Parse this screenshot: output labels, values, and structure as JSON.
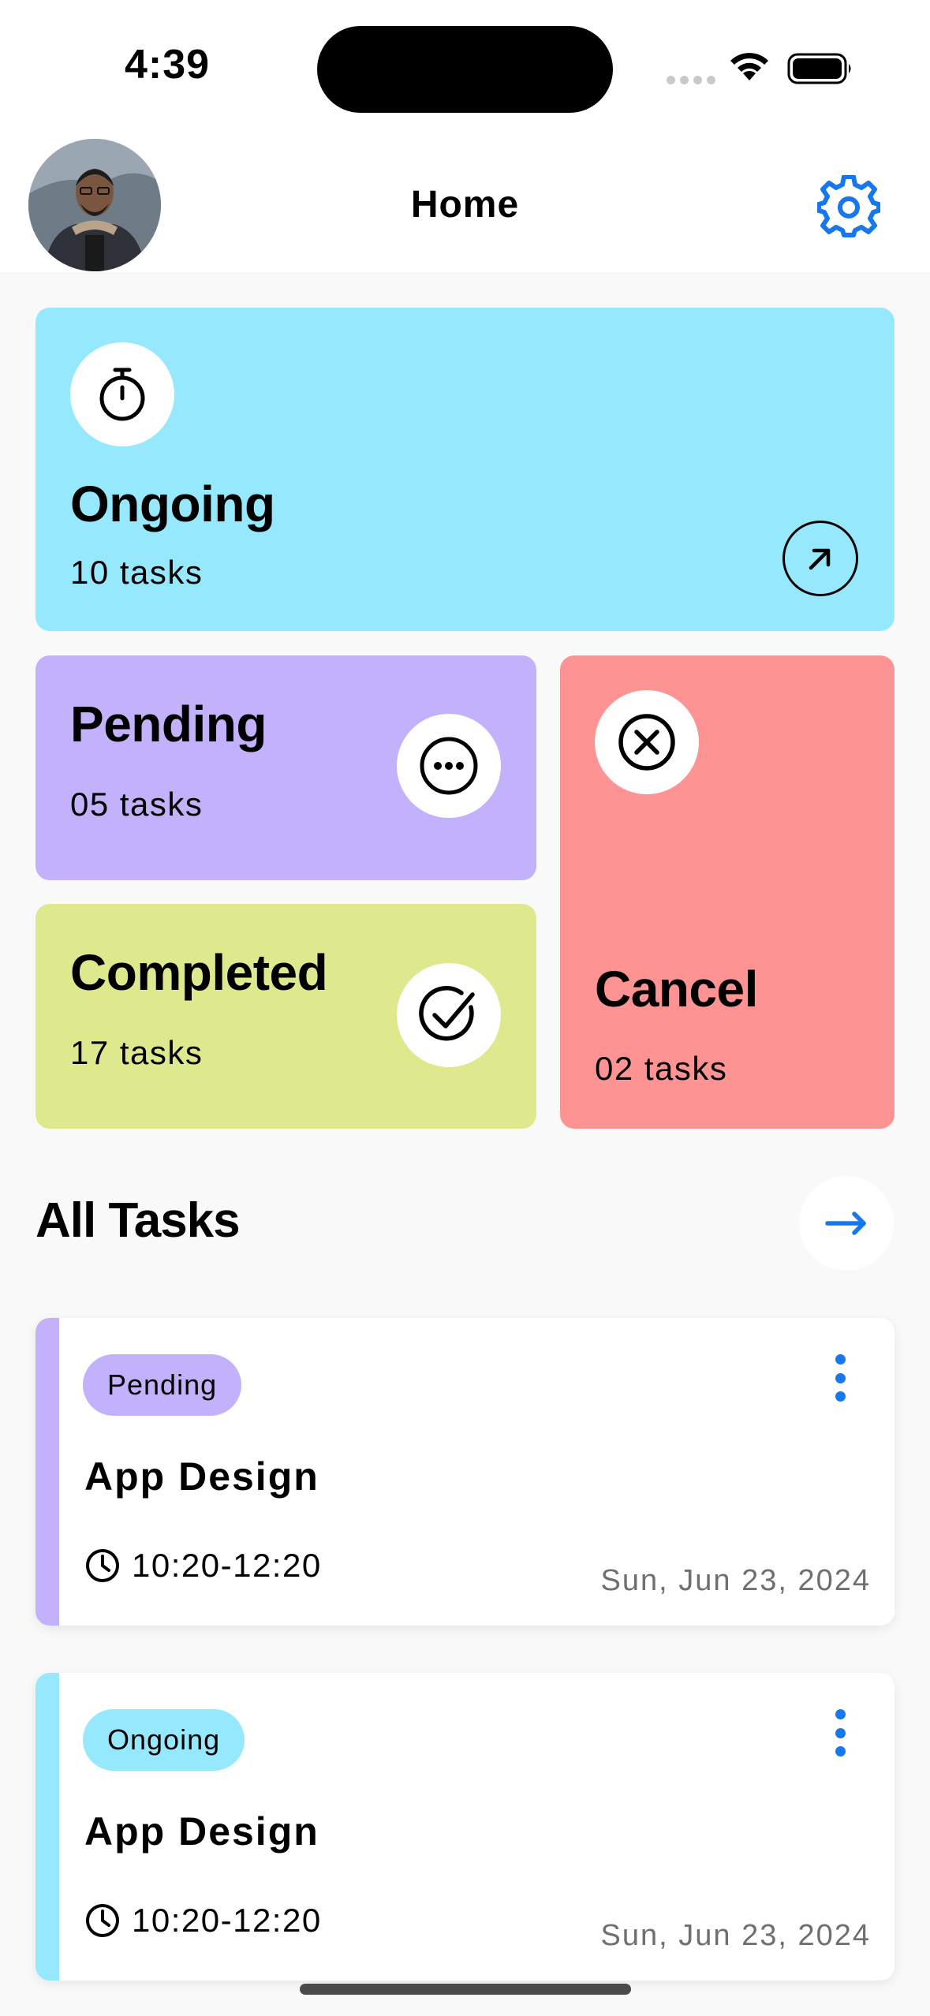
{
  "status_bar": {
    "time": "4:39"
  },
  "header": {
    "title": "Home"
  },
  "summary": {
    "ongoing": {
      "title": "Ongoing",
      "count": "10 tasks"
    },
    "pending": {
      "title": "Pending",
      "count": "05 tasks"
    },
    "completed": {
      "title": "Completed",
      "count": "17 tasks"
    },
    "cancel": {
      "title": "Cancel",
      "count": "02 tasks"
    }
  },
  "all_tasks": {
    "title": "All Tasks",
    "items": [
      {
        "status": "Pending",
        "name": "App Design",
        "time": "10:20-12:20",
        "date": "Sun, Jun 23, 2024"
      },
      {
        "status": "Ongoing",
        "name": "App Design",
        "time": "10:20-12:20",
        "date": "Sun, Jun 23, 2024"
      }
    ]
  },
  "colors": {
    "accent": "#1677ee",
    "ongoing": "#96e9fd",
    "pending": "#c3b1fb",
    "completed": "#dee88c",
    "cancel": "#fd9393"
  },
  "icons": {
    "avatar": "profile-photo",
    "settings": "gear-icon",
    "ongoing": "stopwatch-icon",
    "pending": "ellipsis-circle-icon",
    "completed": "check-circle-icon",
    "cancel": "x-circle-icon",
    "open": "arrow-up-right-icon",
    "all_tasks": "arrow-right-icon",
    "menu": "kebab-icon",
    "time": "clock-icon"
  }
}
